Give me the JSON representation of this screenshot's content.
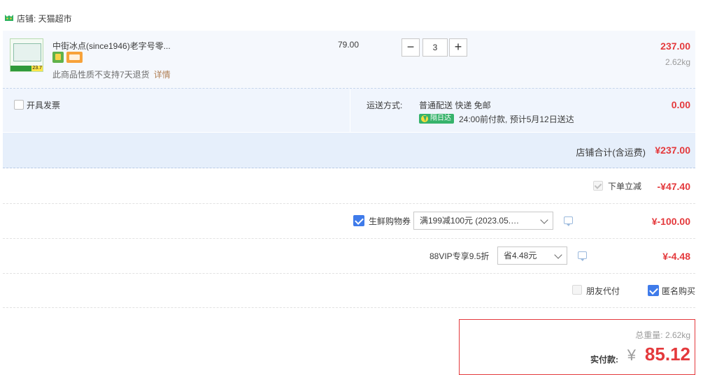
{
  "shop": {
    "label": "店铺: 天猫超市",
    "icon": "tmall-cat-icon"
  },
  "item": {
    "title": "中街冰点(since1946)老字号零...",
    "notice": "此商品性质不支持7天退货",
    "notice_link": "详情",
    "unit_price": "79.00",
    "quantity": "3",
    "minus": "−",
    "plus": "+",
    "line_total": "237.00",
    "weight": "2.62kg",
    "badges": [
      "service-badge-icon",
      "card-badge-icon"
    ]
  },
  "invoice": {
    "label": "开具发票",
    "checked": false
  },
  "shipping": {
    "label": "运送方式:",
    "options": "普通配送 快递 免邮",
    "tag": "隔日达",
    "delivery": "24:00前付款, 预计5月12日送达",
    "fee": "0.00"
  },
  "subtotal": {
    "label": "店铺合计(含运费)",
    "value": "¥237.00"
  },
  "discounts": {
    "instant": {
      "label": "下单立减",
      "value": "-¥47.40",
      "checked": true
    },
    "coupon": {
      "label": "生鲜购物券",
      "selected": "满199减100元 (2023.05.…",
      "value": "¥-100.00",
      "checked": true
    },
    "vip": {
      "label": "88VIP专享9.5折",
      "selected": "省4.48元",
      "value": "¥-4.48"
    }
  },
  "options": {
    "friend_pay": {
      "label": "朋友代付",
      "checked": false
    },
    "anonymous": {
      "label": "匿名购买",
      "checked": true
    }
  },
  "summary": {
    "weight_text": "总重量: 2.62kg",
    "pay_label": "实付款:",
    "currency": "¥",
    "amount": "85.12"
  },
  "colors": {
    "price_red": "#e4393c",
    "check_blue": "#3f7bea",
    "row_bg": "#f5f8fd"
  }
}
